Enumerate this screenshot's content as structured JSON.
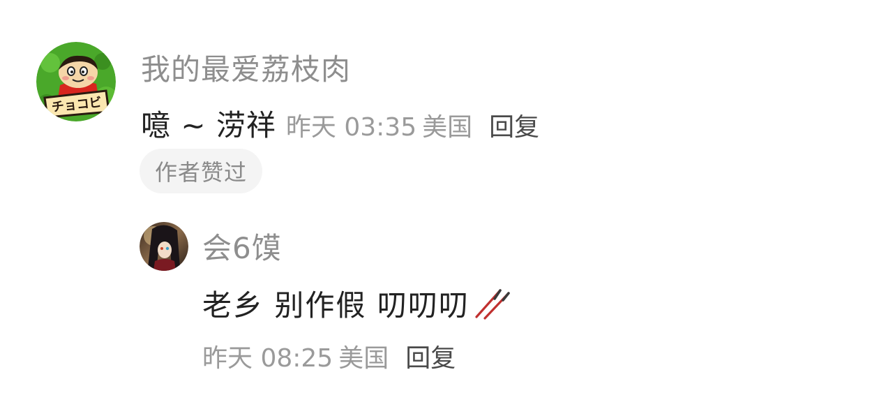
{
  "comment": {
    "username": "我的最爱荔枝肉",
    "text": "噫 ~ 涝祥",
    "time": "昨天 03:35",
    "location": "美国",
    "reply_label": "回复",
    "badge": "作者赞过",
    "avatar_icon": "cartoon-avatar-icon",
    "avatar_text": "チョコビ"
  },
  "reply": {
    "username": "会6馍",
    "text": "老乡 别作假 叨叨叨",
    "emoji_icon": "chopsticks-icon",
    "time": "昨天 08:25",
    "location": "美国",
    "reply_label": "回复",
    "avatar_icon": "anime-avatar-icon"
  },
  "colors": {
    "username": "#8e8e8e",
    "text": "#222222",
    "meta": "#9a9a9a",
    "badge_bg": "#f4f4f4",
    "chopsticks": "#c0302f"
  }
}
